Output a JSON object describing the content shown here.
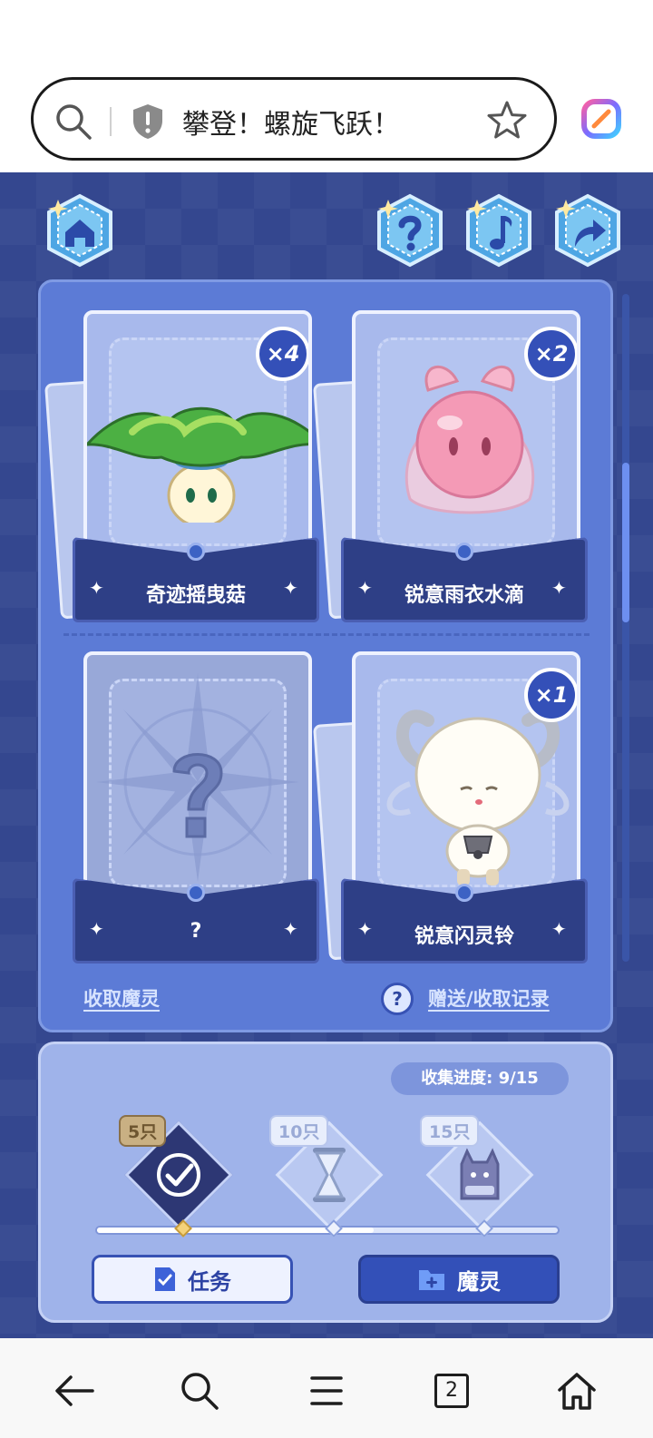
{
  "browser": {
    "title": "攀登！螺旋飞跃！",
    "tab_count": "2"
  },
  "header_buttons": [
    {
      "name": "home",
      "icon": "home-icon"
    },
    {
      "name": "help",
      "icon": "question-icon"
    },
    {
      "name": "music",
      "icon": "music-note-icon"
    },
    {
      "name": "share",
      "icon": "share-arrow-icon"
    }
  ],
  "cards": [
    {
      "label": "奇迹摇曳菇",
      "count": "×4",
      "creature": "green-mushroom"
    },
    {
      "label": "锐意雨衣水滴",
      "count": "×2",
      "creature": "pink-bubble"
    },
    {
      "label": "?",
      "count": "",
      "creature": "unknown"
    },
    {
      "label": "锐意闪灵铃",
      "count": "×1",
      "creature": "white-goat"
    }
  ],
  "links": {
    "collect": "收取魔灵",
    "history": "赠送/收取记录",
    "help": "?"
  },
  "progress": {
    "label": "收集进度: 9/15",
    "value": 9,
    "total": 15,
    "milestones": [
      {
        "tag": "5只",
        "done": true,
        "reward": "checkmark-reward"
      },
      {
        "tag": "10只",
        "done": false,
        "reward": "hourglass-reward"
      },
      {
        "tag": "15只",
        "done": false,
        "reward": "cat-box-reward"
      }
    ]
  },
  "buttons": {
    "task": "任务",
    "spirit": "魔灵"
  },
  "colors": {
    "background": "#34478f",
    "panel": "#5c7bd6",
    "accent": "#3350b8"
  }
}
